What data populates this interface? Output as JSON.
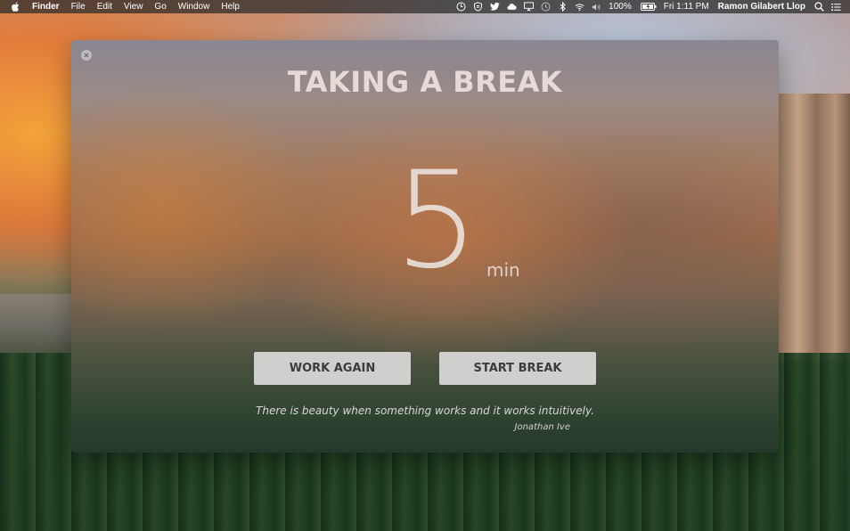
{
  "menubar": {
    "app_name": "Finder",
    "items": [
      "File",
      "Edit",
      "View",
      "Go",
      "Window",
      "Help"
    ],
    "status_icons": [
      "clock-icon",
      "shield-icon",
      "twitter-icon",
      "cloud-icon",
      "airplay-icon",
      "time-machine-icon",
      "bluetooth-icon",
      "wifi-icon",
      "volume-icon"
    ],
    "battery_percent": "100%",
    "clock": "Fri 1:11 PM",
    "user_name": "Ramon Gilabert Llop"
  },
  "break_window": {
    "title": "TAKING A BREAK",
    "duration_value": "5",
    "duration_unit": "min",
    "work_again_label": "WORK AGAIN",
    "start_break_label": "START BREAK",
    "quote": "There is beauty when something works and it works intuitively.",
    "quote_author": "Jonathan Ive"
  }
}
